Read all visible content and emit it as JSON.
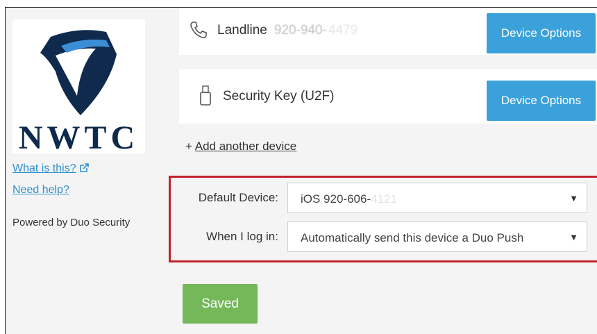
{
  "brand": {
    "logo_text": "NWTC"
  },
  "sidebar": {
    "what_is_this": "What is this?",
    "need_help": "Need help?",
    "powered_by": "Powered by Duo Security"
  },
  "devices": [
    {
      "icon": "phone-icon",
      "type": "Landline",
      "number": "920-940-",
      "number_blurred": "4479",
      "button": "Device Options"
    },
    {
      "icon": "usb-key-icon",
      "type": "Security Key (U2F)",
      "button": "Device Options"
    }
  ],
  "add_device": {
    "plus": "+",
    "label": "Add another device"
  },
  "settings": {
    "default_device_label": "Default Device:",
    "default_device_value": "iOS 920-606-",
    "default_device_blurred": "4121",
    "login_label": "When I log in:",
    "login_value": "Automatically send this device a Duo Push"
  },
  "saved_button": "Saved",
  "colors": {
    "button_blue": "#3ba1da",
    "saved_green": "#75b85a",
    "highlight_red": "#c0232b",
    "logo_navy": "#0f2a4d",
    "link_blue": "#2d8fd0"
  }
}
